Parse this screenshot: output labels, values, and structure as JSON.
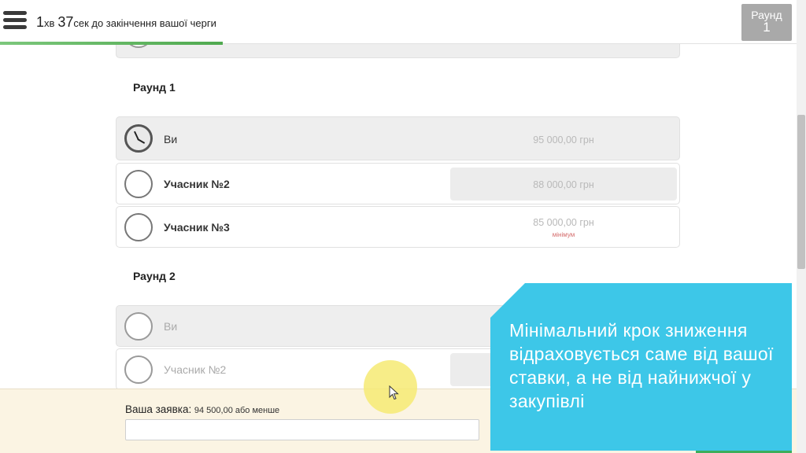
{
  "header": {
    "timer_minutes": "1",
    "timer_min_unit": "хв",
    "timer_seconds": "37",
    "timer_rest": "сек до закінчення вашої черги",
    "progress": 0.28,
    "round_label": "Раунд",
    "round_number": "1"
  },
  "rounds": [
    {
      "title": "Раунд 1",
      "participants": [
        {
          "name": "Ви",
          "amount": "95 000,00 грн",
          "status": "active-turn"
        },
        {
          "name": "Учасник №2",
          "amount": "88 000,00 грн"
        },
        {
          "name": "Учасник №3",
          "amount": "85 000,00 грн",
          "badge": "мінімум"
        }
      ]
    },
    {
      "title": "Раунд 2",
      "participants": [
        {
          "name": "Ви"
        },
        {
          "name": "Учасник №2"
        }
      ]
    }
  ],
  "bid": {
    "label": "Ваша заявка:",
    "hint": "94 500,00 або менше",
    "value": ""
  },
  "note": {
    "text": "Мінімальний крок зниження відраховується саме від вашої ставки, а не від найнижчої у закупівлі"
  },
  "colors": {
    "accent_note": "#3dc7e8",
    "progress": "#4fa94f",
    "minimum_badge": "#d46a6a",
    "bid_panel": "#fbf4e3"
  }
}
